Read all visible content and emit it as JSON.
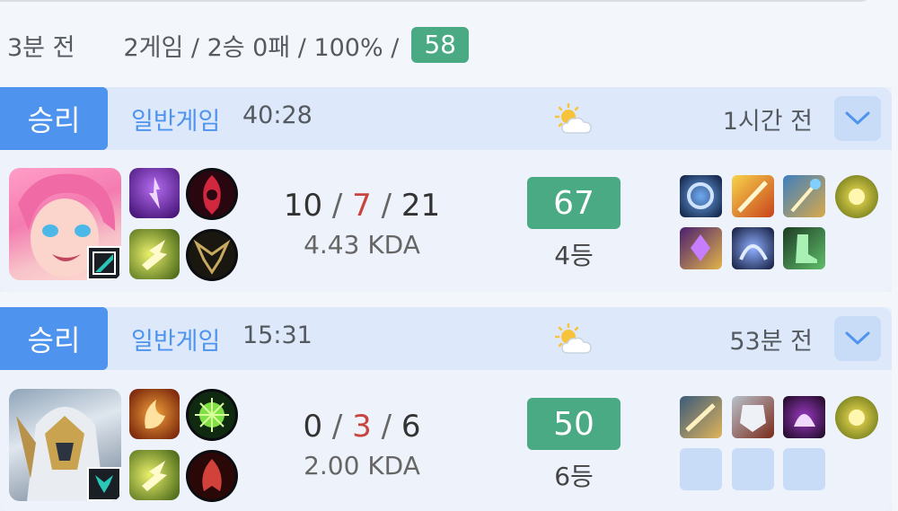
{
  "summary": {
    "time": "3분 전",
    "stats": "2게임 / 2승 0패 / 100% /",
    "score": "58"
  },
  "matches": [
    {
      "result": "승리",
      "mode": "일반게임",
      "duration": "40:28",
      "ago": "1시간 전",
      "kills": "10",
      "deaths": "7",
      "assists": "21",
      "kda_ratio": "4.43 KDA",
      "rating": "67",
      "rank": "4등",
      "champion_icon": "seraphine-portrait",
      "items": [
        "item-rod-of-ages",
        "item-fire-sword",
        "item-staff",
        "item-warding-totem",
        "item-amulet",
        "item-rune-blade",
        "item-boots"
      ],
      "empty_item_slots": 0
    },
    {
      "result": "승리",
      "mode": "일반게임",
      "duration": "15:31",
      "ago": "53분 전",
      "kills": "0",
      "deaths": "3",
      "assists": "6",
      "kda_ratio": "2.00 KDA",
      "rating": "50",
      "rank": "6등",
      "champion_icon": "armored-knight-portrait",
      "items": [
        "item-shield-blade",
        "item-plate-armor",
        "item-dark-helm",
        "item-warding-totem"
      ],
      "empty_item_slots": 3
    }
  ],
  "colors": {
    "win_badge": "#4e93ee",
    "rating_green": "#4aaa84",
    "deaths_red": "#c8443e",
    "header_bg": "#dde9fb"
  }
}
